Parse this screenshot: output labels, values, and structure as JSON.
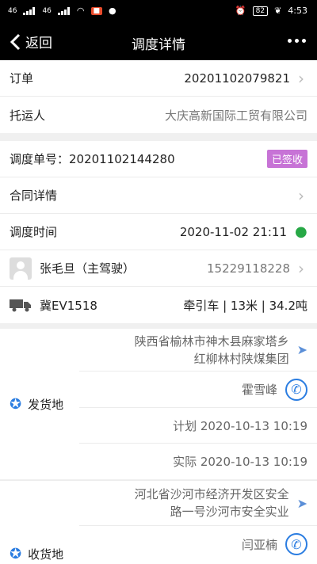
{
  "status_bar": {
    "signal1": "46",
    "signal2": "46",
    "battery": "82",
    "time": "4:53"
  },
  "nav": {
    "back_label": "返回",
    "title": "调度详情"
  },
  "order": {
    "label": "订单",
    "value": "20201102079821"
  },
  "shipper": {
    "label": "托运人",
    "value": "大庆高新国际工贸有限公司"
  },
  "dispatch": {
    "label": "调度单号：20201102144280",
    "status": "已签收"
  },
  "contract": {
    "label": "合同详情"
  },
  "schedule": {
    "label": "调度时间",
    "value": "2020-11-02 21:11"
  },
  "driver": {
    "name": "张毛旦（主驾驶）",
    "phone": "15229118228"
  },
  "vehicle": {
    "plate": "冀EV1518",
    "spec": "牵引车 | 13米 | 34.2吨"
  },
  "origin": {
    "title": "发货地",
    "address_line1": "陕西省榆林市神木县麻家塔乡",
    "address_line2": "红柳林村陕煤集团",
    "contact": "霍雪峰",
    "planned": "计划 2020-10-13 10:19",
    "actual": "实际 2020-10-13 10:19"
  },
  "destination": {
    "title": "收货地",
    "address_line1": "河北省沙河市经济开发区安全",
    "address_line2": "路一号沙河市安全实业",
    "contact": "闫亚楠"
  },
  "colors": {
    "badge": "#c773d6",
    "location_pin": "#27a846",
    "phone": "#2b7de1"
  }
}
